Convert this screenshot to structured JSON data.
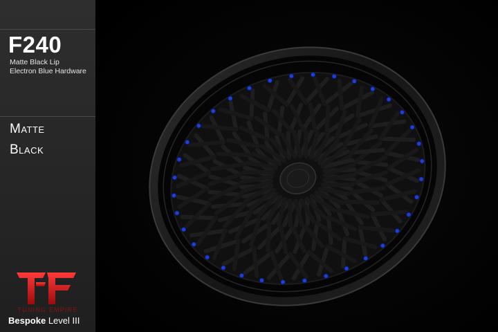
{
  "product": {
    "model": "F240",
    "subtitle_line1": "Matte Black Lip",
    "subtitle_line2": "Electron Blue Hardware",
    "finish_line1": "Matte",
    "finish_line2": "Black"
  },
  "brand": {
    "name": "TUNING EMPIRE",
    "tier_bold": "Bespoke",
    "tier_level": "Level III",
    "logo_color": "#d41a1a"
  },
  "wheel": {
    "finish_color": "#141414",
    "hardware_color": "#1f3fd8",
    "logo_icon": "center-cap-icon"
  }
}
